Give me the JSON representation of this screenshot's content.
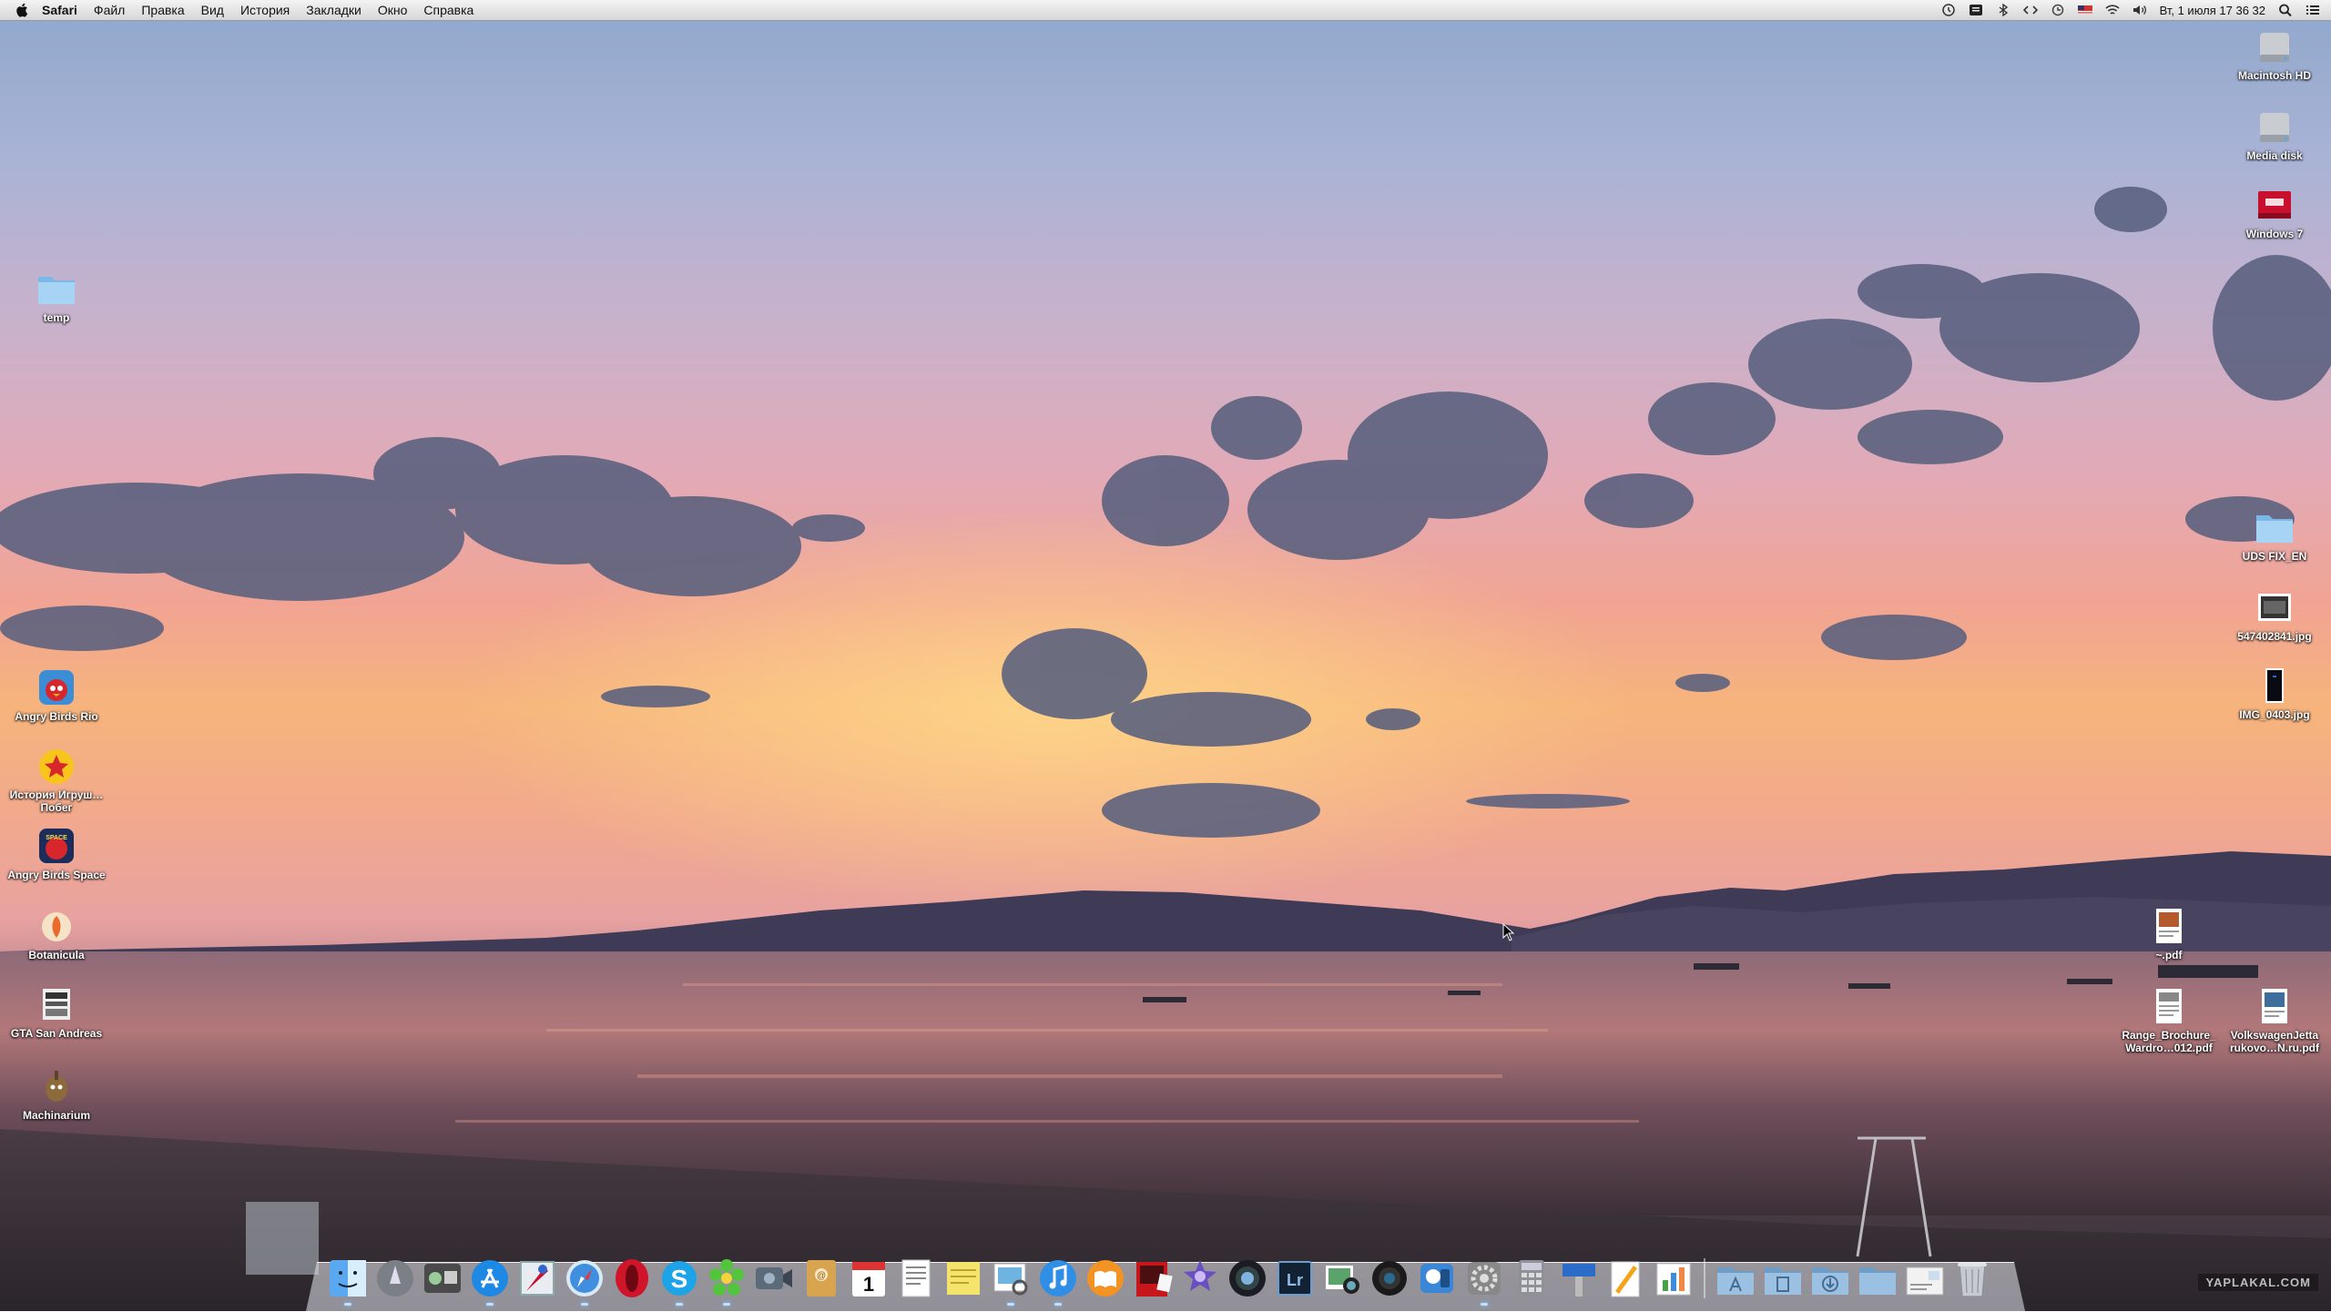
{
  "menubar": {
    "app_name": "Safari",
    "menus": [
      "Файл",
      "Правка",
      "Вид",
      "История",
      "Закладки",
      "Окно",
      "Справка"
    ],
    "clock": "Вт, 1 июля  17 36 32",
    "status_icons": [
      "time-machine-icon",
      "notes-icon",
      "bluetooth-icon",
      "code-icon",
      "history-icon",
      "flag-icon",
      "wifi-icon",
      "volume-icon"
    ]
  },
  "desktop_right": [
    {
      "label": "Macintosh HD",
      "icon": "hard-drive-icon"
    },
    {
      "label": "Media disk",
      "icon": "hard-drive-icon"
    },
    {
      "label": "Windows 7",
      "icon": "parallels-vm-icon"
    },
    {
      "label": "UDS FIX_EN",
      "icon": "folder-icon"
    },
    {
      "label": "547402841.jpg",
      "icon": "image-file-icon"
    },
    {
      "label": "IMG_0403.jpg",
      "icon": "image-file-icon"
    },
    {
      "label": "~.pdf",
      "icon": "pdf-file-icon"
    },
    {
      "label": "Range_Brochure_ Wardro…012.pdf",
      "icon": "pdf-file-icon"
    },
    {
      "label": "VolkswagenJetta rukovo…N.ru.pdf",
      "icon": "pdf-file-icon"
    }
  ],
  "desktop_left": [
    {
      "label": "temp",
      "icon": "folder-icon"
    },
    {
      "label": "Angry Birds Rio",
      "icon": "angry-birds-rio-icon"
    },
    {
      "label": "История Игруш…Побег",
      "icon": "toy-story-icon"
    },
    {
      "label": "Angry Birds Space",
      "icon": "angry-birds-space-icon"
    },
    {
      "label": "Botanicula",
      "icon": "botanicula-icon"
    },
    {
      "label": "GTA San Andreas",
      "icon": "gta-icon"
    },
    {
      "label": "Machinarium",
      "icon": "machinarium-icon"
    }
  ],
  "dock": {
    "apps": [
      "finder-icon",
      "launchpad-icon",
      "dashboard-icon",
      "app-store-icon",
      "mail-stamp-icon",
      "safari-icon",
      "opera-icon",
      "skype-icon",
      "icq-icon",
      "facetime-icon",
      "address-book-icon",
      "calendar-icon",
      "textedit-icon",
      "stickies-icon",
      "preview-icon",
      "itunes-icon",
      "ibooks-icon",
      "photo-booth-icon",
      "imovie-icon",
      "aperture-icon",
      "lightroom-icon",
      "iphoto-icon",
      "camera-icon",
      "vlc-icon",
      "system-preferences-icon",
      "calculator-icon",
      "keynote-icon",
      "pages-icon",
      "numbers-icon"
    ],
    "stacks": [
      "applications-stack-icon",
      "documents-stack-icon",
      "downloads-stack-icon",
      "folder-stack-icon",
      "mail-stack-icon",
      "trash-icon"
    ],
    "calendar_day": "1",
    "lightroom_text": "Lr",
    "skype_text": "S"
  },
  "watermark": "YAPLAKAL.COM"
}
